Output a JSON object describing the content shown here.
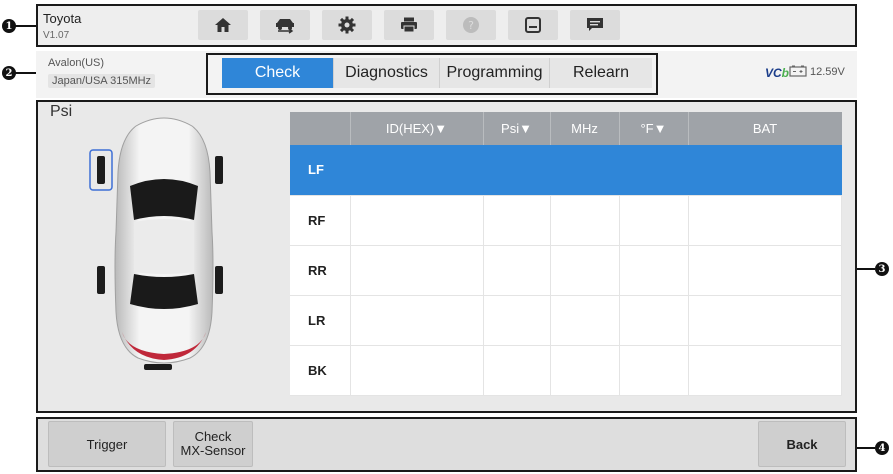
{
  "callouts": [
    "1",
    "2",
    "3",
    "4"
  ],
  "header": {
    "brand": "Toyota",
    "version": "V1.07",
    "toolbar_icons": [
      "home-icon",
      "vehicle-swap-icon",
      "gear-icon",
      "printer-icon",
      "help-icon",
      "save-icon",
      "message-icon"
    ]
  },
  "vehicle_info": {
    "model": "Avalon(US)",
    "region": "Japan/USA 315MHz"
  },
  "tabs": [
    {
      "label": "Check",
      "active": true
    },
    {
      "label": "Diagnostics",
      "active": false
    },
    {
      "label": "Programming",
      "active": false
    },
    {
      "label": "Relearn",
      "active": false
    }
  ],
  "status": {
    "vci_prefix": "VC",
    "vci_suffix": "b",
    "voltage": "12.59V"
  },
  "main": {
    "unit": "Psi",
    "table": {
      "columns": [
        "",
        "ID(HEX)▼",
        "Psi▼",
        "MHz",
        "°F▼",
        "BAT"
      ],
      "rows": [
        {
          "pos": "LF",
          "id": "",
          "psi": "",
          "mhz": "",
          "temp": "",
          "bat": "",
          "selected": true
        },
        {
          "pos": "RF",
          "id": "",
          "psi": "",
          "mhz": "",
          "temp": "",
          "bat": "",
          "selected": false
        },
        {
          "pos": "RR",
          "id": "",
          "psi": "",
          "mhz": "",
          "temp": "",
          "bat": "",
          "selected": false
        },
        {
          "pos": "LR",
          "id": "",
          "psi": "",
          "mhz": "",
          "temp": "",
          "bat": "",
          "selected": false
        },
        {
          "pos": "BK",
          "id": "",
          "psi": "",
          "mhz": "",
          "temp": "",
          "bat": "",
          "selected": false
        }
      ]
    }
  },
  "footer": {
    "trigger": "Trigger",
    "check_mx_line1": "Check",
    "check_mx_line2": "MX-Sensor",
    "back": "Back"
  },
  "colors": {
    "accent": "#2f86d8",
    "header_bg": "#eeeeee",
    "table_header": "#9fa3a8"
  }
}
